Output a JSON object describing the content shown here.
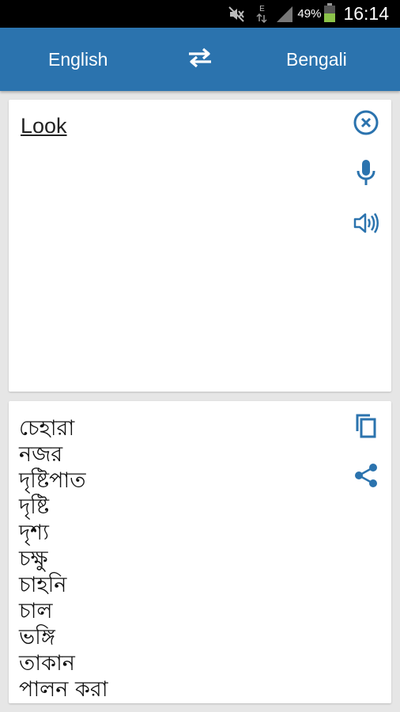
{
  "status_bar": {
    "network": "E",
    "battery_percent": "49%",
    "time": "16:14",
    "icons": [
      "mute-icon",
      "data-arrows-icon",
      "signal-icon",
      "battery-icon"
    ]
  },
  "toolbar": {
    "source_lang": "English",
    "target_lang": "Bengali",
    "swap_icon": "swap-arrows-icon"
  },
  "input": {
    "text": "Look",
    "icons": [
      "clear-icon",
      "microphone-icon",
      "speaker-icon"
    ]
  },
  "output": {
    "translations": [
      "চেহারা",
      "নজর",
      "দৃষ্টিপাত",
      "দৃষ্টি",
      "দৃশ্য",
      "চক্ষু",
      "চাহনি",
      "চাল",
      "ভঙ্গি",
      "তাকান",
      "পালন করা"
    ],
    "icons": [
      "copy-icon",
      "share-icon"
    ]
  },
  "colors": {
    "app_bar": "#2b73ae",
    "accent_icon": "#2b73ae",
    "background": "#e6e6e6",
    "battery_fill": "#8bc34a"
  }
}
